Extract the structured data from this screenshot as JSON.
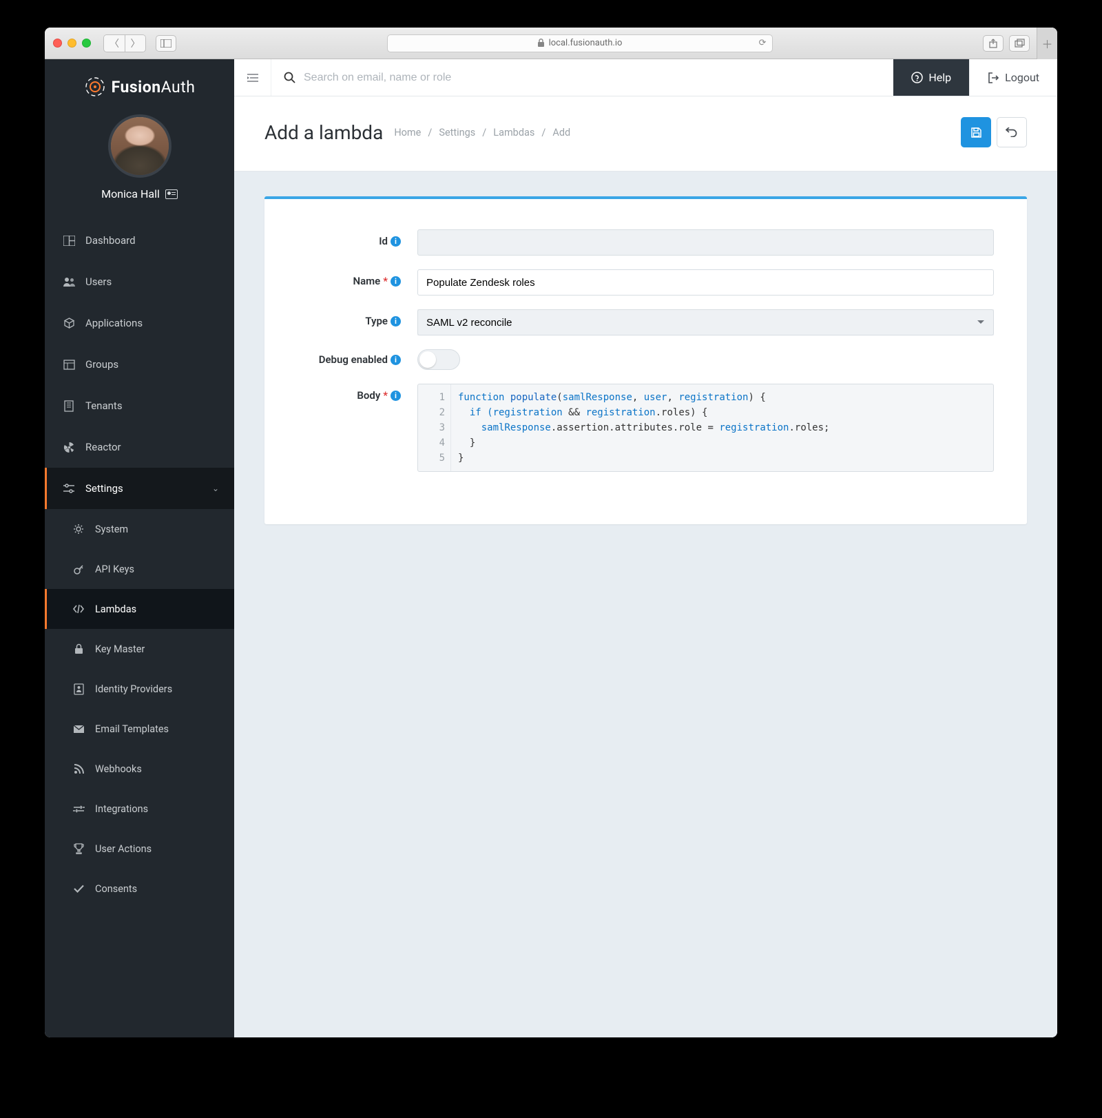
{
  "browser": {
    "url_host": "local.fusionauth.io"
  },
  "brand": {
    "part1": "Fusion",
    "part2": "Auth"
  },
  "profile": {
    "name": "Monica Hall"
  },
  "topbar": {
    "search_placeholder": "Search on email, name or role",
    "help": "Help",
    "logout": "Logout"
  },
  "nav": {
    "dashboard": "Dashboard",
    "users": "Users",
    "applications": "Applications",
    "groups": "Groups",
    "tenants": "Tenants",
    "reactor": "Reactor",
    "settings": "Settings",
    "sub": {
      "system": "System",
      "api_keys": "API Keys",
      "lambdas": "Lambdas",
      "key_master": "Key Master",
      "identity_providers": "Identity Providers",
      "email_templates": "Email Templates",
      "webhooks": "Webhooks",
      "integrations": "Integrations",
      "user_actions": "User Actions",
      "consents": "Consents"
    }
  },
  "page": {
    "title": "Add a lambda",
    "crumbs": {
      "home": "Home",
      "settings": "Settings",
      "lambdas": "Lambdas",
      "add": "Add"
    }
  },
  "form": {
    "labels": {
      "id": "Id",
      "name": "Name",
      "type": "Type",
      "debug": "Debug enabled",
      "body": "Body"
    },
    "values": {
      "id": "",
      "name": "Populate Zendesk roles",
      "type": "SAML v2 reconcile",
      "debug": false
    },
    "code": {
      "lines": [
        "1",
        "2",
        "3",
        "4",
        "5"
      ],
      "l1a": "function",
      "l1b": " populate",
      "l1c": "(",
      "l1d": "samlResponse",
      "l1e": ", ",
      "l1f": "user",
      "l1g": ", ",
      "l1h": "registration",
      "l1i": ") {",
      "l2a": "  if (",
      "l2b": "registration",
      "l2c": " && ",
      "l2d": "registration",
      "l2e": ".roles) {",
      "l3a": "    ",
      "l3b": "samlResponse",
      "l3c": ".assertion.attributes.role = ",
      "l3d": "registration",
      "l3e": ".roles;",
      "l4": "  }",
      "l5": "}"
    }
  }
}
